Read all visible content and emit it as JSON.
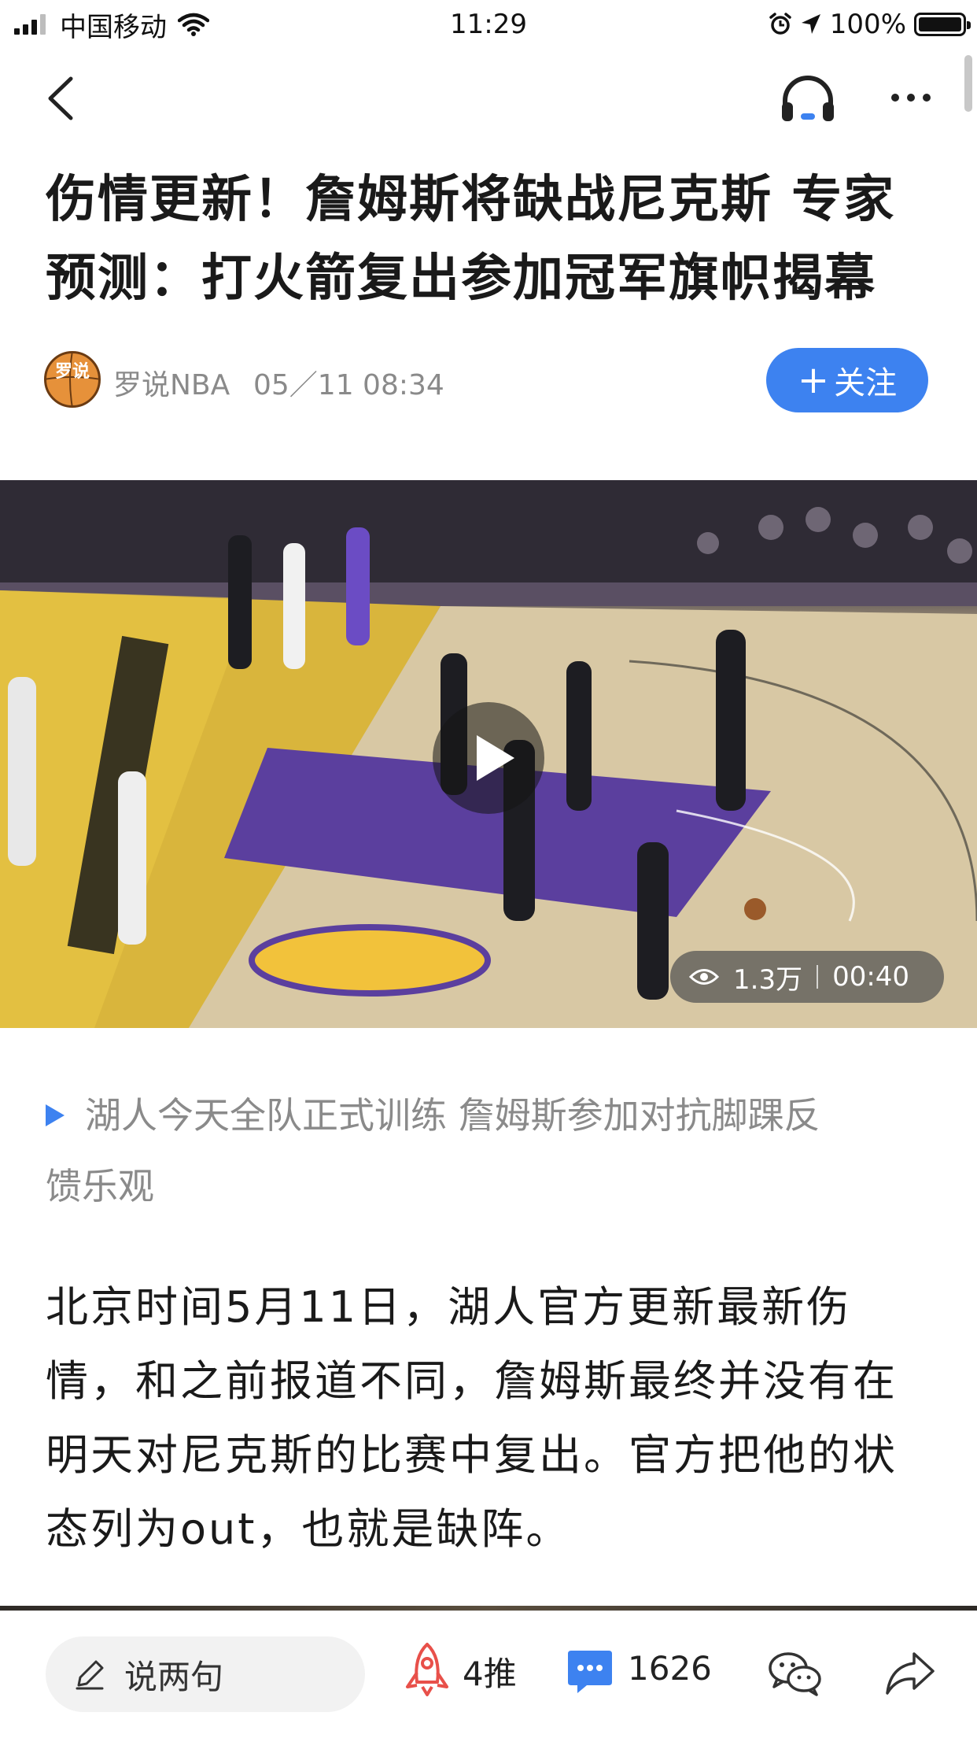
{
  "status_bar": {
    "carrier": "中国移动",
    "time": "11:29",
    "battery": "100%"
  },
  "nav": {
    "icons": [
      "back-icon",
      "headphones-icon",
      "more-icon"
    ]
  },
  "article": {
    "title_line1": "伤情更新！詹姆斯将缺战尼克斯 专家",
    "title_line2": "预测：打火箭复出参加冠军旗帜揭幕",
    "author": "罗说NBA",
    "avatar_text": "罗说",
    "publish_time": "05／11 08:34",
    "follow_label": "关注",
    "video": {
      "views": "1.3万",
      "duration": "00:40"
    },
    "related_line1": "湖人今天全队正式训练 詹姆斯参加对抗脚踝反",
    "related_line2": "馈乐观",
    "body_line1": "北京时间5月11日，湖人官方更新最新伤",
    "body_line2": "情，和之前报道不同，詹姆斯最终并没有在",
    "body_line3": "明天对尼克斯的比赛中复出。官方把他的状",
    "body_line4": "态列为out，也就是缺阵。"
  },
  "bottom_bar": {
    "comment_placeholder": "说两句",
    "tui_label": "4推",
    "comment_count": "1626"
  },
  "colors": {
    "accent": "#3d82f0",
    "muted_text": "#8a8a8a"
  }
}
